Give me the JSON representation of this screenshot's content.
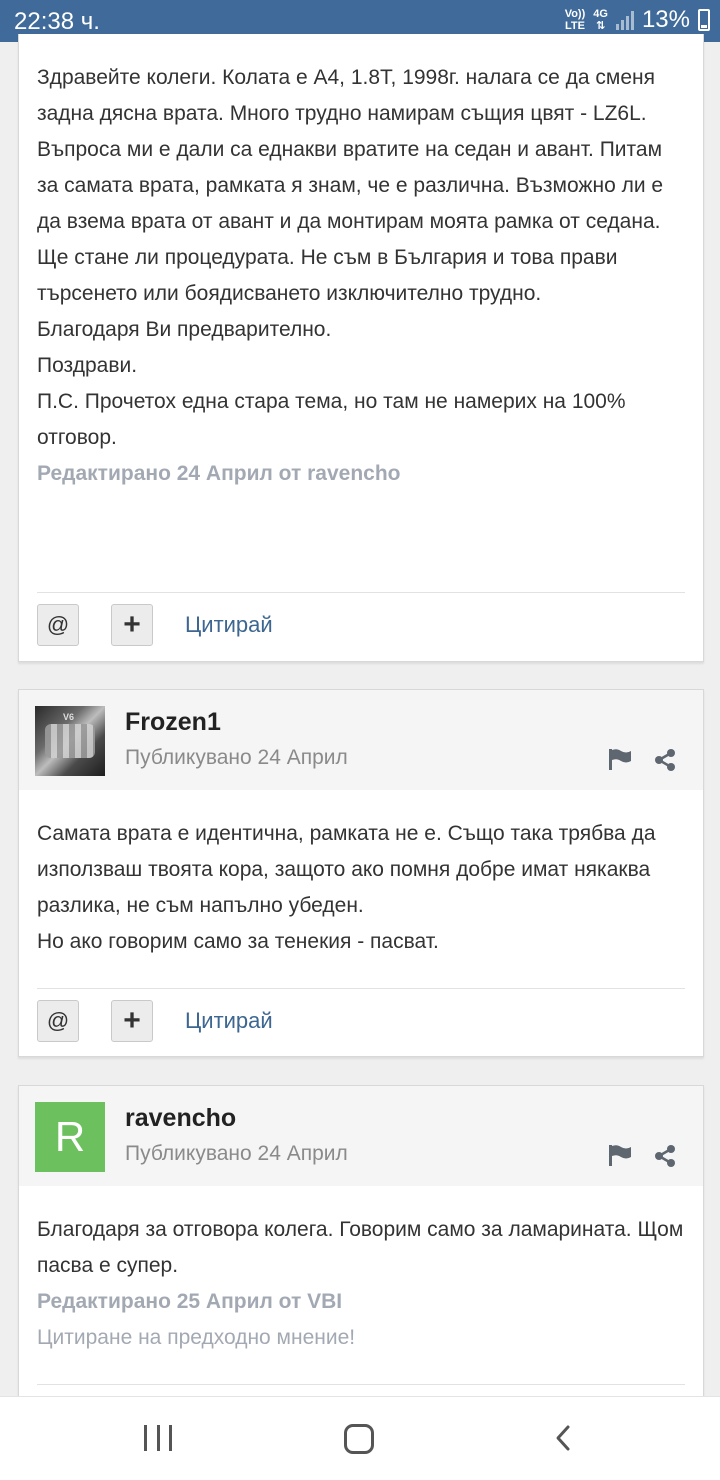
{
  "status_bar": {
    "time": "22:38 ч.",
    "network_top": "Vo))",
    "network_bottom": "LTE",
    "data_type": "4G",
    "battery": "13%",
    "icons": [
      "signal-icon",
      "battery-icon"
    ]
  },
  "posts": [
    {
      "body": [
        "Здравейте колеги. Колата е А4, 1.8Т, 1998г. налага се да сменя задна дясна врата. Много трудно намирам същия цвят - LZ6L.",
        "Въпроса ми е дали са еднакви вратите на седан и авант. Питам за самата врата, рамката я знам, че е различна. Възможно ли е да взема врата от авант и да монтирам моята рамка от седана. Ще стане ли процедурата. Не съм в България и това прави търсенето или боядисването изключително трудно.",
        "Благодаря Ви предварително.",
        "Поздрави.",
        "П.С. Прочетох една стара тема, но там не намерих на 100% отговор."
      ],
      "edited": "Редактирано 24 Април от ravencho",
      "actions": {
        "mention": "@",
        "multiquote": "+",
        "quote": "Цитирай"
      }
    },
    {
      "author": "Frozen1",
      "avatar": "engine-photo",
      "avatar_text": "V6",
      "posted": "Публикувано 24 Април",
      "body": [
        "Самата врата е идентична, рамката не е. Също така трябва да използваш твоята кора, защото ако помня добре имат някаква разлика, не съм напълно убеден.",
        "Но ако говорим само за тенекия - пасват."
      ],
      "actions": {
        "mention": "@",
        "multiquote": "+",
        "quote": "Цитирай"
      }
    },
    {
      "author": "ravencho",
      "avatar_letter": "R",
      "avatar_color": "#6cc05d",
      "posted": "Публикувано 24 Април",
      "body": [
        "Благодаря за отговора колега. Говорим само за ламарината. Щом пасва е супер."
      ],
      "edited": "Редактирано 25 Април от VBI",
      "quoted_note": "Цитиране на предходно мнение!"
    }
  ],
  "nav_bar": {
    "buttons": [
      "recent-apps-icon",
      "home-icon",
      "back-icon"
    ]
  },
  "colors": {
    "status_bar": "#3f6a9a",
    "link": "#3d6690",
    "muted": "#a3a9b3",
    "avatar_green": "#6cc05d"
  }
}
